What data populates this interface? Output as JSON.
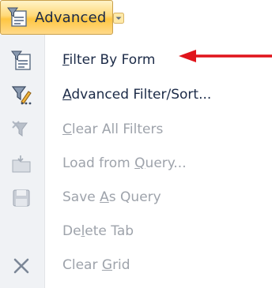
{
  "ribbon": {
    "advanced_button": {
      "label": "Advanced",
      "icon": "filter-form-icon",
      "dropdown_icon": "chevron-down-icon"
    }
  },
  "menu": {
    "items": [
      {
        "label_pre": "",
        "mnemonic": "F",
        "label_post": "ilter By Form",
        "icon": "filter-by-form-icon",
        "enabled": true
      },
      {
        "label_pre": "",
        "mnemonic": "A",
        "label_post": "dvanced Filter/Sort...",
        "icon": "advanced-filter-icon",
        "enabled": true
      },
      {
        "label_pre": "",
        "mnemonic": "C",
        "label_post": "lear All Filters",
        "icon": "clear-filters-icon",
        "enabled": false
      },
      {
        "label_pre": "Load from ",
        "mnemonic": "Q",
        "label_post": "uery...",
        "icon": "load-query-icon",
        "enabled": false
      },
      {
        "label_pre": "Save ",
        "mnemonic": "A",
        "label_post": "s Query",
        "icon": "save-query-icon",
        "enabled": false
      },
      {
        "label_pre": "De",
        "mnemonic": "l",
        "label_post": "ete Tab",
        "icon": "",
        "enabled": false
      },
      {
        "label_pre": "Clear ",
        "mnemonic": "G",
        "label_post": "rid",
        "icon": "close-icon",
        "enabled": false
      }
    ]
  },
  "annotation": {
    "arrow_color": "#e0141b",
    "arrow_icon": "red-arrow-icon"
  },
  "colors": {
    "text_enabled": "#1b2a47",
    "text_disabled": "#9ea3ab",
    "gutter": "#f0f2f5",
    "button_highlight": "#ffc641"
  }
}
